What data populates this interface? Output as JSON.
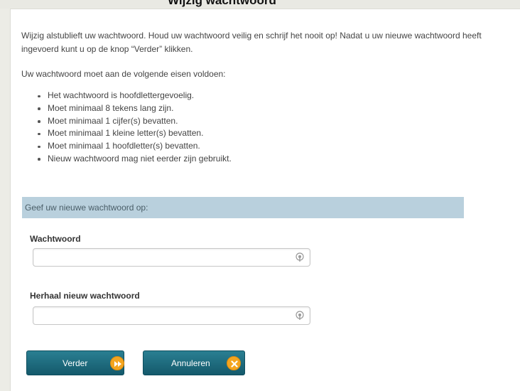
{
  "page": {
    "cut_heading": "Wijzig wachtwoord",
    "intro": "Wijzig alstublieft uw wachtwoord. Houd uw wachtwoord veilig en schrijf het nooit op! Nadat u uw nieuwe wachtwoord heeft ingevoerd kunt u op de knop “Verder” klikken.",
    "requirements_title": "Uw wachtwoord moet aan de volgende eisen voldoen:",
    "requirements": [
      "Het wachtwoord is hoofdlettergevoelig.",
      "Moet minimaal 8 tekens lang zijn.",
      "Moet minimaal 1 cijfer(s) bevatten.",
      "Moet minimaal 1 kleine letter(s) bevatten.",
      "Moet minimaal 1 hoofdletter(s) bevatten.",
      "Nieuw wachtwoord mag niet eerder zijn gebruikt."
    ]
  },
  "form": {
    "section_header": "Geef uw nieuwe wachtwoord op:",
    "password_label": "Wachtwoord",
    "password_value": "",
    "repeat_label": "Herhaal nieuw wachtwoord",
    "repeat_value": ""
  },
  "buttons": {
    "next_label": "Verder",
    "next_icon": "fast-forward-icon",
    "cancel_label": "Annuleren",
    "cancel_icon": "close-icon"
  },
  "colors": {
    "button": "#1d6b7e",
    "button_icon": "#f4a51f",
    "section_header": "#b9d0dd"
  }
}
